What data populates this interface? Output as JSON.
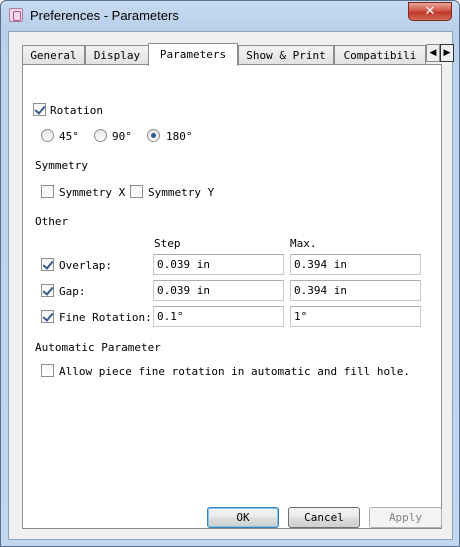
{
  "window": {
    "title": "Preferences - Parameters"
  },
  "tabs": [
    "General",
    "Display",
    "Parameters",
    "Show & Print",
    "Compatibili"
  ],
  "rotation": {
    "header": "Rotation",
    "checked": true,
    "options": [
      "45°",
      "90°",
      "180°"
    ],
    "selected": "180°"
  },
  "symmetry": {
    "header": "Symmetry",
    "x_label": "Symmetry X",
    "y_label": "Symmetry Y"
  },
  "other": {
    "header": "Other",
    "step_label": "Step",
    "max_label": "Max.",
    "rows": [
      {
        "label": "Overlap:",
        "checked": true,
        "step": "0.039 in",
        "max": "0.394 in"
      },
      {
        "label": "Gap:",
        "checked": true,
        "step": "0.039 in",
        "max": "0.394 in"
      },
      {
        "label": "Fine Rotation:",
        "checked": true,
        "step": "0.1°",
        "max": "1°"
      }
    ]
  },
  "automatic": {
    "header": "Automatic Parameter",
    "option_label": "Allow piece fine rotation in automatic and fill hole."
  },
  "buttons": {
    "ok": "OK",
    "cancel": "Cancel",
    "apply": "Apply"
  }
}
